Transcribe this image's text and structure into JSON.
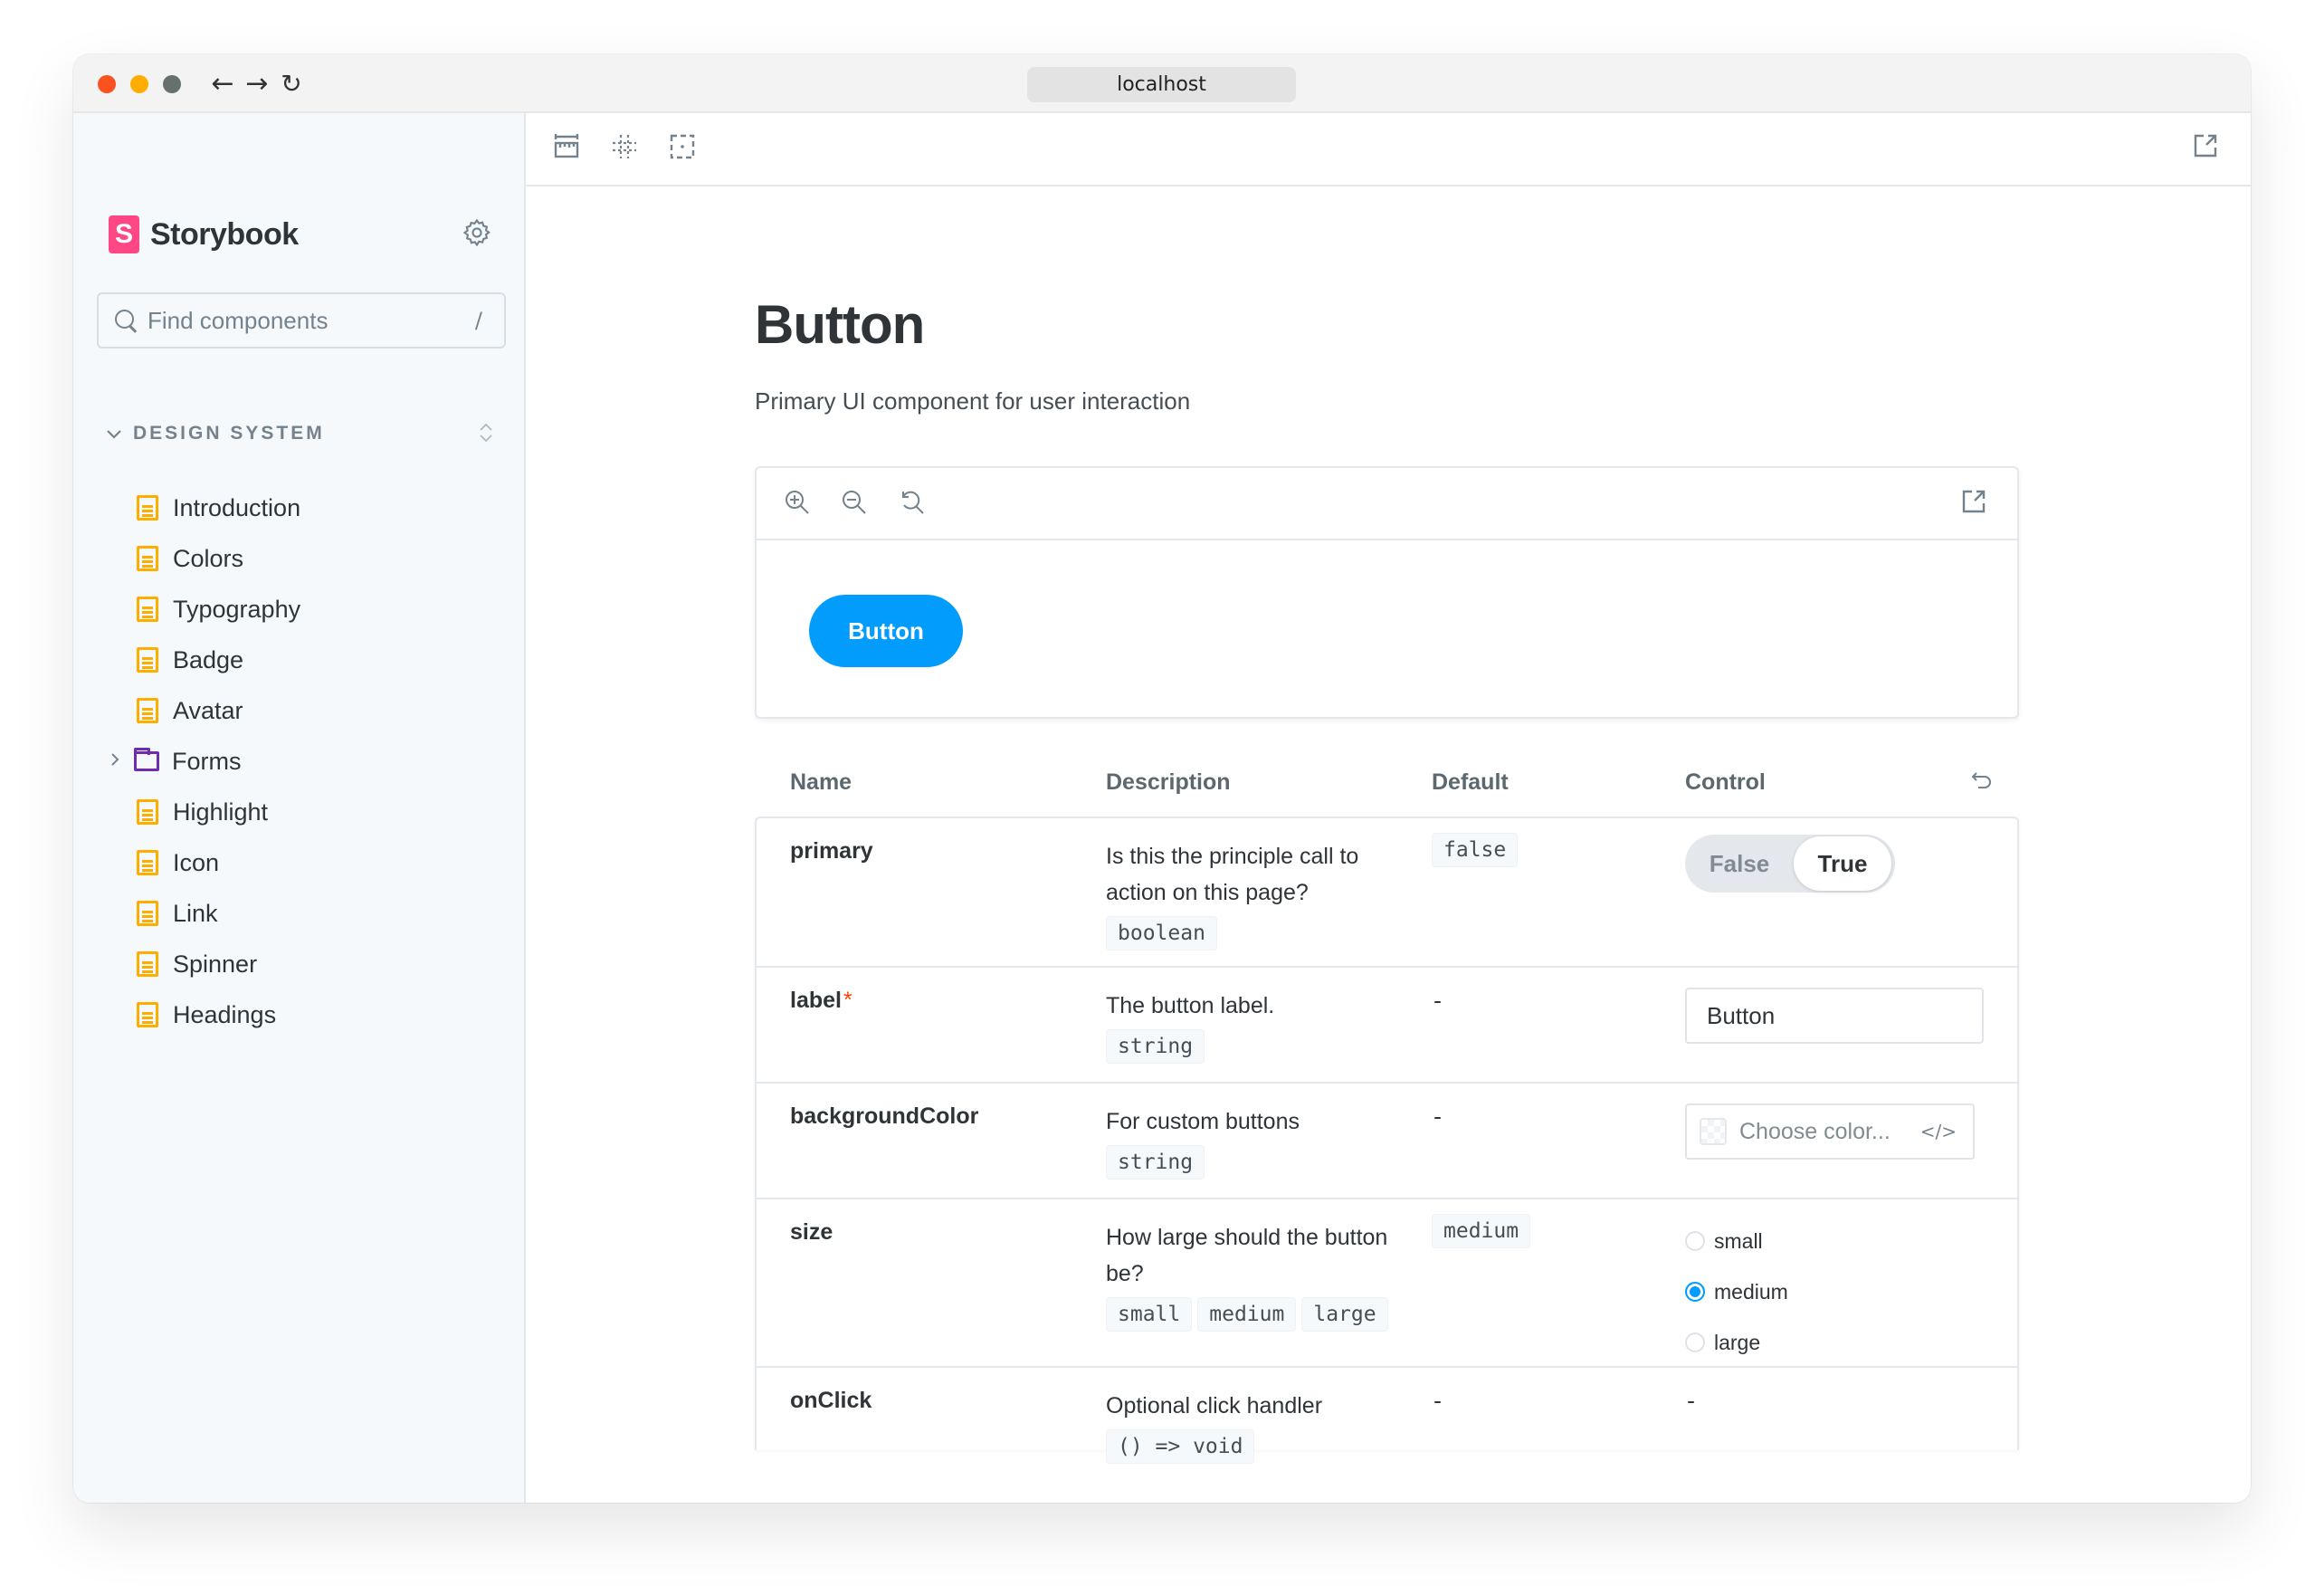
{
  "browser": {
    "url": "localhost",
    "back_icon": "←",
    "forward_icon": "→",
    "reload_icon": "↻"
  },
  "sidebar": {
    "brand": {
      "logo_letter": "S",
      "name": "Storybook"
    },
    "search": {
      "placeholder": "Find components",
      "shortcut": "/"
    },
    "group": {
      "label": "DESIGN SYSTEM",
      "chevron": "⌄"
    },
    "items": [
      {
        "label": "Introduction",
        "type": "doc"
      },
      {
        "label": "Colors",
        "type": "doc"
      },
      {
        "label": "Typography",
        "type": "doc"
      },
      {
        "label": "Badge",
        "type": "doc"
      },
      {
        "label": "Avatar",
        "type": "doc"
      },
      {
        "label": "Forms",
        "type": "folder",
        "expander": "›"
      },
      {
        "label": "Highlight",
        "type": "doc"
      },
      {
        "label": "Icon",
        "type": "doc"
      },
      {
        "label": "Link",
        "type": "doc"
      },
      {
        "label": "Spinner",
        "type": "doc"
      },
      {
        "label": "Headings",
        "type": "doc"
      }
    ]
  },
  "docs": {
    "title": "Button",
    "description": "Primary UI component for user interaction",
    "preview": {
      "button_label": "Button",
      "button_color": "#029cfd"
    },
    "args_table": {
      "headers": {
        "name": "Name",
        "description": "Description",
        "default": "Default",
        "control": "Control"
      },
      "reset_icon": "↺",
      "rows": [
        {
          "name": "primary",
          "required": false,
          "description": "Is this the principle call to action on this page?",
          "types": [
            "boolean"
          ],
          "default": "false",
          "control": {
            "type": "boolean",
            "options": [
              "False",
              "True"
            ],
            "value": "True"
          }
        },
        {
          "name": "label",
          "required": true,
          "required_mark": "*",
          "description": "The button label.",
          "types": [
            "string"
          ],
          "default": "-",
          "control": {
            "type": "text",
            "value": "Button"
          }
        },
        {
          "name": "backgroundColor",
          "required": false,
          "description": "For custom buttons",
          "types": [
            "string"
          ],
          "default": "-",
          "control": {
            "type": "color",
            "placeholder": "Choose color...",
            "code_icon": "</>"
          }
        },
        {
          "name": "size",
          "required": false,
          "description": "How large should the button be?",
          "types": [
            "small",
            "medium",
            "large"
          ],
          "default": "medium",
          "control": {
            "type": "radio",
            "options": [
              "small",
              "medium",
              "large"
            ],
            "value": "medium"
          }
        },
        {
          "name": "onClick",
          "required": false,
          "description": "Optional click handler",
          "types": [
            "() => void"
          ],
          "default": "-",
          "control": {
            "type": "none",
            "value": "-"
          }
        }
      ]
    }
  },
  "colors": {
    "accent": "#029cfd",
    "brand": "#ff4785",
    "doc_icon": "#ffae00",
    "folder_icon": "#6f2cac",
    "required": "#ff4400"
  }
}
